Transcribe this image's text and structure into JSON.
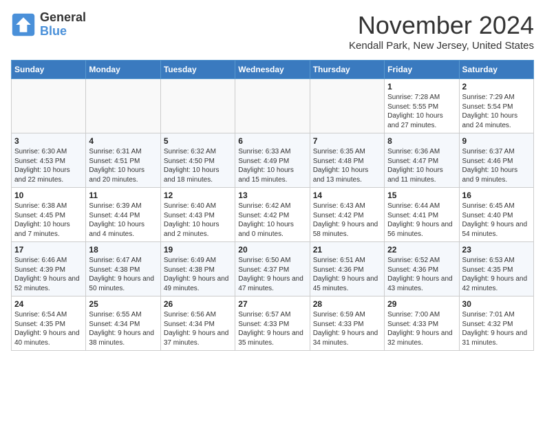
{
  "logo": {
    "line1": "General",
    "line2": "Blue"
  },
  "title": "November 2024",
  "location": "Kendall Park, New Jersey, United States",
  "weekdays": [
    "Sunday",
    "Monday",
    "Tuesday",
    "Wednesday",
    "Thursday",
    "Friday",
    "Saturday"
  ],
  "weeks": [
    [
      {
        "day": "",
        "info": ""
      },
      {
        "day": "",
        "info": ""
      },
      {
        "day": "",
        "info": ""
      },
      {
        "day": "",
        "info": ""
      },
      {
        "day": "",
        "info": ""
      },
      {
        "day": "1",
        "info": "Sunrise: 7:28 AM\nSunset: 5:55 PM\nDaylight: 10 hours and 27 minutes."
      },
      {
        "day": "2",
        "info": "Sunrise: 7:29 AM\nSunset: 5:54 PM\nDaylight: 10 hours and 24 minutes."
      }
    ],
    [
      {
        "day": "3",
        "info": "Sunrise: 6:30 AM\nSunset: 4:53 PM\nDaylight: 10 hours and 22 minutes."
      },
      {
        "day": "4",
        "info": "Sunrise: 6:31 AM\nSunset: 4:51 PM\nDaylight: 10 hours and 20 minutes."
      },
      {
        "day": "5",
        "info": "Sunrise: 6:32 AM\nSunset: 4:50 PM\nDaylight: 10 hours and 18 minutes."
      },
      {
        "day": "6",
        "info": "Sunrise: 6:33 AM\nSunset: 4:49 PM\nDaylight: 10 hours and 15 minutes."
      },
      {
        "day": "7",
        "info": "Sunrise: 6:35 AM\nSunset: 4:48 PM\nDaylight: 10 hours and 13 minutes."
      },
      {
        "day": "8",
        "info": "Sunrise: 6:36 AM\nSunset: 4:47 PM\nDaylight: 10 hours and 11 minutes."
      },
      {
        "day": "9",
        "info": "Sunrise: 6:37 AM\nSunset: 4:46 PM\nDaylight: 10 hours and 9 minutes."
      }
    ],
    [
      {
        "day": "10",
        "info": "Sunrise: 6:38 AM\nSunset: 4:45 PM\nDaylight: 10 hours and 7 minutes."
      },
      {
        "day": "11",
        "info": "Sunrise: 6:39 AM\nSunset: 4:44 PM\nDaylight: 10 hours and 4 minutes."
      },
      {
        "day": "12",
        "info": "Sunrise: 6:40 AM\nSunset: 4:43 PM\nDaylight: 10 hours and 2 minutes."
      },
      {
        "day": "13",
        "info": "Sunrise: 6:42 AM\nSunset: 4:42 PM\nDaylight: 10 hours and 0 minutes."
      },
      {
        "day": "14",
        "info": "Sunrise: 6:43 AM\nSunset: 4:42 PM\nDaylight: 9 hours and 58 minutes."
      },
      {
        "day": "15",
        "info": "Sunrise: 6:44 AM\nSunset: 4:41 PM\nDaylight: 9 hours and 56 minutes."
      },
      {
        "day": "16",
        "info": "Sunrise: 6:45 AM\nSunset: 4:40 PM\nDaylight: 9 hours and 54 minutes."
      }
    ],
    [
      {
        "day": "17",
        "info": "Sunrise: 6:46 AM\nSunset: 4:39 PM\nDaylight: 9 hours and 52 minutes."
      },
      {
        "day": "18",
        "info": "Sunrise: 6:47 AM\nSunset: 4:38 PM\nDaylight: 9 hours and 50 minutes."
      },
      {
        "day": "19",
        "info": "Sunrise: 6:49 AM\nSunset: 4:38 PM\nDaylight: 9 hours and 49 minutes."
      },
      {
        "day": "20",
        "info": "Sunrise: 6:50 AM\nSunset: 4:37 PM\nDaylight: 9 hours and 47 minutes."
      },
      {
        "day": "21",
        "info": "Sunrise: 6:51 AM\nSunset: 4:36 PM\nDaylight: 9 hours and 45 minutes."
      },
      {
        "day": "22",
        "info": "Sunrise: 6:52 AM\nSunset: 4:36 PM\nDaylight: 9 hours and 43 minutes."
      },
      {
        "day": "23",
        "info": "Sunrise: 6:53 AM\nSunset: 4:35 PM\nDaylight: 9 hours and 42 minutes."
      }
    ],
    [
      {
        "day": "24",
        "info": "Sunrise: 6:54 AM\nSunset: 4:35 PM\nDaylight: 9 hours and 40 minutes."
      },
      {
        "day": "25",
        "info": "Sunrise: 6:55 AM\nSunset: 4:34 PM\nDaylight: 9 hours and 38 minutes."
      },
      {
        "day": "26",
        "info": "Sunrise: 6:56 AM\nSunset: 4:34 PM\nDaylight: 9 hours and 37 minutes."
      },
      {
        "day": "27",
        "info": "Sunrise: 6:57 AM\nSunset: 4:33 PM\nDaylight: 9 hours and 35 minutes."
      },
      {
        "day": "28",
        "info": "Sunrise: 6:59 AM\nSunset: 4:33 PM\nDaylight: 9 hours and 34 minutes."
      },
      {
        "day": "29",
        "info": "Sunrise: 7:00 AM\nSunset: 4:33 PM\nDaylight: 9 hours and 32 minutes."
      },
      {
        "day": "30",
        "info": "Sunrise: 7:01 AM\nSunset: 4:32 PM\nDaylight: 9 hours and 31 minutes."
      }
    ]
  ]
}
